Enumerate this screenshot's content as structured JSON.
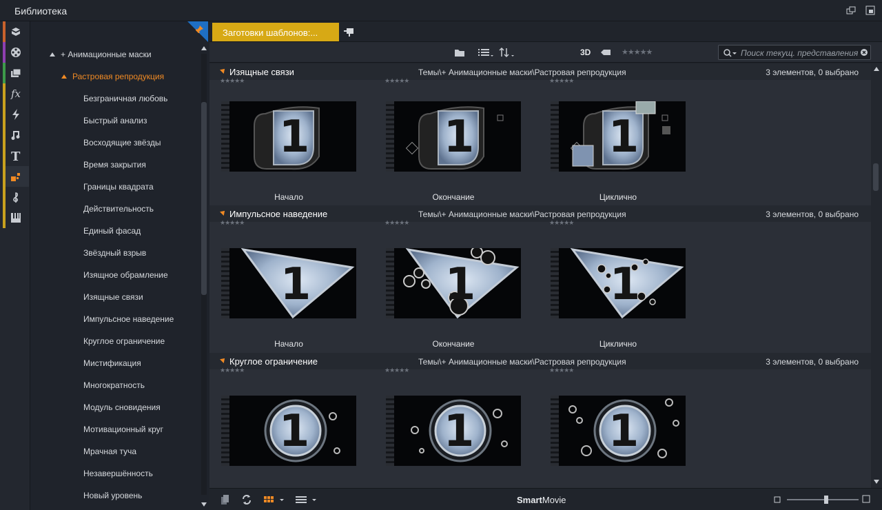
{
  "window": {
    "title": "Библиотека"
  },
  "rail": {
    "items": [
      {
        "name": "project-bin-icon",
        "color": "#c9622c"
      },
      {
        "name": "film-reel-icon",
        "color": "#8e3fb0"
      },
      {
        "name": "photos-icon",
        "color": "#3d9a4a"
      },
      {
        "name": "fx-icon",
        "color": "#c9a11e"
      },
      {
        "name": "lightning-icon",
        "color": "#c9a11e"
      },
      {
        "name": "music-note-icon",
        "color": "#c9a11e"
      },
      {
        "name": "title-icon",
        "color": "#c9a11e"
      },
      {
        "name": "themes-icon",
        "color": "#c9a11e"
      },
      {
        "name": "treble-clef-icon",
        "color": "#c9a11e"
      },
      {
        "name": "piano-icon",
        "color": "#c9a11e"
      }
    ],
    "selected_index": 7
  },
  "tree": {
    "root": "+ Анимационные маски",
    "active": "Растровая репродукция",
    "items": [
      "Безграничная любовь",
      "Быстрый анализ",
      "Восходящие звёзды",
      "Время закрытия",
      "Границы квадрата",
      "Действительность",
      "Единый фасад",
      "Звёздный взрыв",
      "Изящное обрамление",
      "Изящные связи",
      "Импульсное наведение",
      "Круглое ограничение",
      "Мистификация",
      "Многократность",
      "Модуль сновидения",
      "Мотивационный круг",
      "Мрачная туча",
      "Незавершённость",
      "Новый уровень"
    ]
  },
  "tabs": {
    "active_label": "Заготовки шаблонов:..."
  },
  "toolbar": {
    "mode_3d": "3D",
    "search_placeholder": "Поиск текущ. представления"
  },
  "groups": [
    {
      "name": "Изящные связи",
      "path": "Темы\\+ Анимационные маски\\Растровая репродукция",
      "count": "3 элементов, 0 выбрано",
      "items": [
        {
          "caption": "Начало",
          "rating": 0
        },
        {
          "caption": "Окончание",
          "rating": 0
        },
        {
          "caption": "Циклично",
          "rating": 0
        }
      ]
    },
    {
      "name": "Импульсное наведение",
      "path": "Темы\\+ Анимационные маски\\Растровая репродукция",
      "count": "3 элементов, 0 выбрано",
      "items": [
        {
          "caption": "Начало",
          "rating": 0
        },
        {
          "caption": "Окончание",
          "rating": 0
        },
        {
          "caption": "Циклично",
          "rating": 0
        }
      ]
    },
    {
      "name": "Круглое ограничение",
      "path": "Темы\\+ Анимационные маски\\Растровая репродукция",
      "count": "3 элементов, 0 выбрано",
      "items": [
        {
          "caption": "",
          "rating": 0
        },
        {
          "caption": "",
          "rating": 0
        },
        {
          "caption": "",
          "rating": 0
        }
      ]
    }
  ],
  "bottom": {
    "brand_bold": "Smart",
    "brand_rest": "Movie",
    "zoom": 0.55
  },
  "colors": {
    "accent": "#f08a24",
    "tab": "#d7a915"
  }
}
